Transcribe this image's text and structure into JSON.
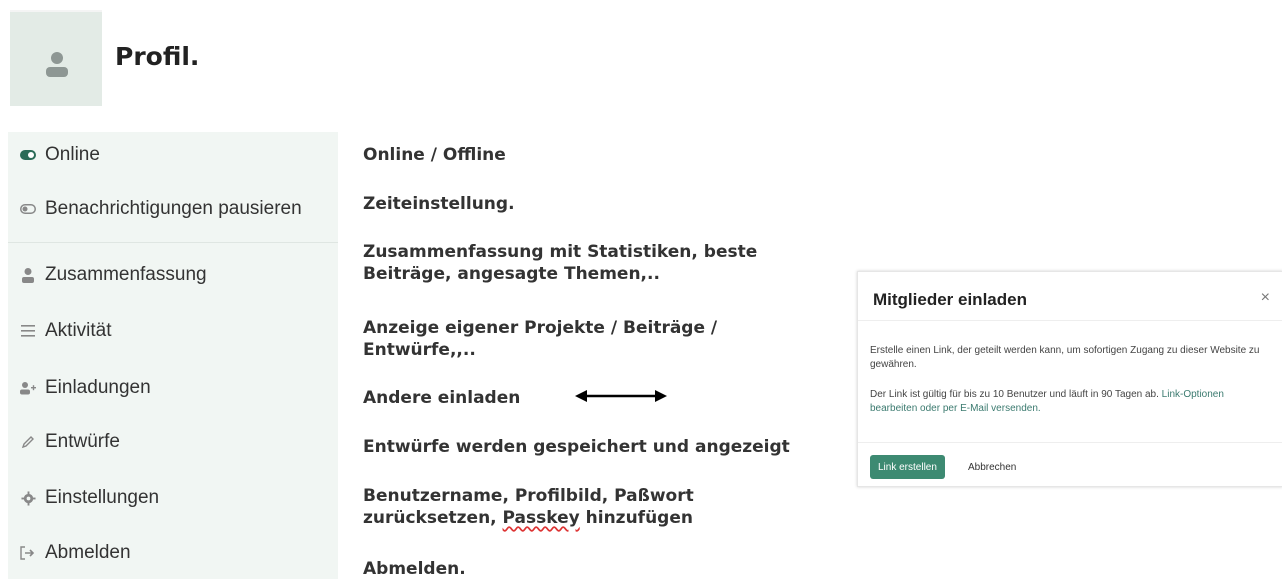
{
  "header": {
    "title": "Profil."
  },
  "sidebar": {
    "items": [
      {
        "label": "Online",
        "icon": "toggle-on-icon"
      },
      {
        "label": "Benachrichtigungen pausieren",
        "icon": "toggle-off-icon"
      },
      {
        "label": "Zusammenfassung",
        "icon": "user-icon"
      },
      {
        "label": "Aktivität",
        "icon": "list-icon"
      },
      {
        "label": "Einladungen",
        "icon": "user-plus-icon"
      },
      {
        "label": "Entwürfe",
        "icon": "pencil-icon"
      },
      {
        "label": "Einstellungen",
        "icon": "gear-icon"
      },
      {
        "label": "Abmelden",
        "icon": "sign-out-icon"
      }
    ]
  },
  "notes": {
    "n1": "Online / Offline",
    "n2": "Zeiteinstellung.",
    "n3a": "Zusammenfassung mit Statistiken, beste",
    "n3b": "Beiträge, angesagte Themen,..",
    "n4a": "Anzeige eigener Projekte / Beiträge /",
    "n4b": "Entwürfe,,..",
    "n5": "Andere einladen",
    "n6": "Entwürfe werden gespeichert und angezeigt",
    "n7a": "Benutzername, Profilbild, Paßwort",
    "n7b_pre": "zurücksetzen, ",
    "n7b_err": "Passkey",
    "n7b_post": " hinzufügen",
    "n8": "Abmelden."
  },
  "modal": {
    "title": "Mitglieder einladen",
    "close": "×",
    "text1": "Erstelle einen Link, der geteilt werden kann, um sofortigen Zugang zu dieser Website zu gewähren.",
    "text2_pre": "Der Link ist gültig für bis zu 10 Benutzer und läuft in 90 Tagen ab. ",
    "text2_link": "Link-Optionen bearbeiten oder per E-Mail versenden.",
    "primary_button": "Link erstellen",
    "secondary_button": "Abbrechen"
  },
  "colors": {
    "accent": "#3d8a72",
    "sidebar_bg": "#f1f6f3",
    "link": "#3b7a6f"
  }
}
